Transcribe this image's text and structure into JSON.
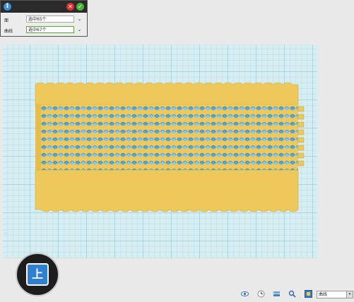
{
  "panel": {
    "rows": [
      {
        "label": "面",
        "value": "选中65个"
      },
      {
        "label": "曲线",
        "value": "选中67个"
      }
    ],
    "info_glyph": "i",
    "cancel_glyph": "✕",
    "confirm_glyph": "✓",
    "chevron_glyph": "⌄"
  },
  "view_cube": {
    "label": "上"
  },
  "toolbar": {
    "icons": [
      "eye-icon",
      "clock-icon",
      "layers-icon",
      "search-icon",
      "view-mode-icon"
    ],
    "select_value": "曲线",
    "select_arrow": "▾"
  },
  "colors": {
    "model_fill": "#ecc95a",
    "model_edge": "#d4ab3a",
    "mesh_blue": "#5aa6d6",
    "canvas_bg": "#d6eef2"
  }
}
